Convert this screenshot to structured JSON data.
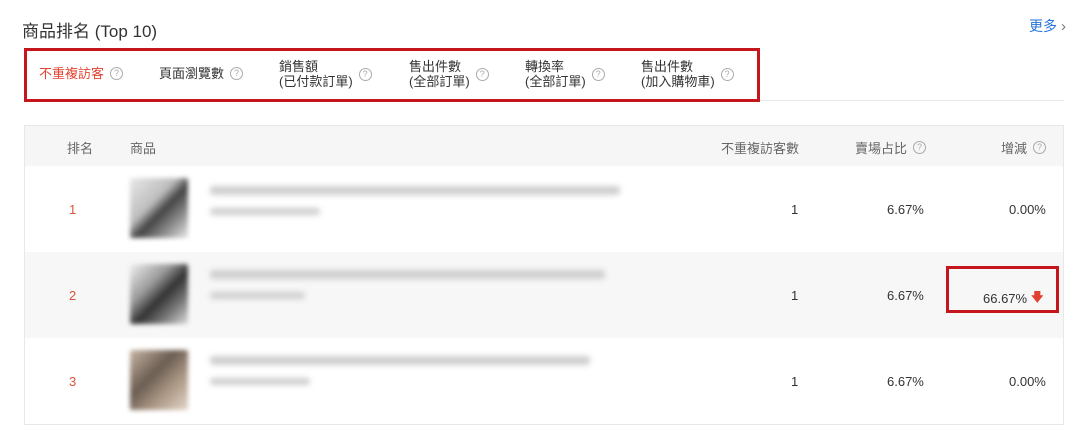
{
  "header": {
    "title": "商品排名 (Top 10)",
    "more_label": "更多",
    "more_icon": "chevron-right-icon"
  },
  "tabs": [
    {
      "label": "不重複訪客",
      "sub": ""
    },
    {
      "label": "頁面瀏覽數",
      "sub": ""
    },
    {
      "label": "銷售額",
      "sub": "(已付款訂單)"
    },
    {
      "label": "售出件數",
      "sub": "(全部訂單)"
    },
    {
      "label": "轉換率",
      "sub": "(全部訂單)"
    },
    {
      "label": "售出件數",
      "sub": "(加入購物車)"
    }
  ],
  "table": {
    "columns": {
      "rank": "排名",
      "product": "商品",
      "visitors": "不重複訪客數",
      "share": "賣場占比",
      "change": "增減"
    },
    "rows": [
      {
        "rank": "1",
        "visitors": "1",
        "share": "6.67%",
        "change": "0.00%",
        "trend": ""
      },
      {
        "rank": "2",
        "visitors": "1",
        "share": "6.67%",
        "change": "66.67%",
        "trend": "down"
      },
      {
        "rank": "3",
        "visitors": "1",
        "share": "6.67%",
        "change": "0.00%",
        "trend": ""
      }
    ]
  },
  "colors": {
    "accent": "#e0422f",
    "highlight_border": "#c4161c",
    "link": "#2673dd"
  }
}
